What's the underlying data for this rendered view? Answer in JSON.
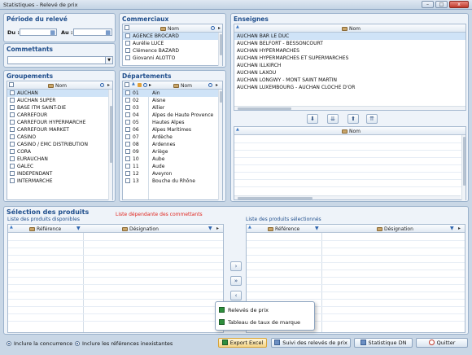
{
  "window": {
    "title": "Statistiques - Relevé de prix"
  },
  "periode": {
    "title": "Période du relevé",
    "du_label": "Du :",
    "au_label": "Au :",
    "du_value": "",
    "au_value": ""
  },
  "commettants": {
    "title": "Commettants",
    "value": ""
  },
  "commerciaux": {
    "title": "Commerciaux",
    "col_nom": "Nom",
    "items": [
      "AGENCE BROCARD",
      "Aurélie LUCE",
      "Clémence BAZARD",
      "Giovanni ALOTTO"
    ]
  },
  "enseignes": {
    "title": "Enseignes",
    "col_nom": "Nom",
    "items": [
      "AUCHAN BAR LE DUC",
      "AUCHAN BELFORT - BESSONCOURT",
      "AUCHAN HYPERMARCHES",
      "AUCHAN HYPERMARCHES ET SUPERMARCHES",
      "AUCHAN ILLKIRCH",
      "AUCHAN LAXOU",
      "AUCHAN LONGWY - MONT SAINT MARTIN",
      "AUCHAN LUXEMBOURG - AUCHAN CLOCHE D'OR"
    ],
    "selected_col_nom": "Nom"
  },
  "groupements": {
    "title": "Groupements",
    "col_nom": "Nom",
    "items": [
      "AUCHAN",
      "AUCHAN SUPER",
      "BASE ITM SAINT-DIE",
      "CARREFOUR",
      "CARREFOUR HYPERMARCHE",
      "CARREFOUR MARKET",
      "CASINO",
      "CASINO / EMC DISTRIBUTION",
      "CORA",
      "EURAUCHAN",
      "GALEC",
      "INDEPENDANT",
      "INTERMARCHE"
    ]
  },
  "departements": {
    "title": "Départements",
    "col_nom": "Nom",
    "items": [
      {
        "code": "01",
        "nom": "Ain"
      },
      {
        "code": "02",
        "nom": "Aisne"
      },
      {
        "code": "03",
        "nom": "Allier"
      },
      {
        "code": "04",
        "nom": "Alpes de Haute Provence"
      },
      {
        "code": "05",
        "nom": "Hautes Alpes"
      },
      {
        "code": "06",
        "nom": "Alpes Maritimes"
      },
      {
        "code": "07",
        "nom": "Ardèche"
      },
      {
        "code": "08",
        "nom": "Ardennes"
      },
      {
        "code": "09",
        "nom": "Ariège"
      },
      {
        "code": "10",
        "nom": "Aube"
      },
      {
        "code": "11",
        "nom": "Aude"
      },
      {
        "code": "12",
        "nom": "Aveyron"
      },
      {
        "code": "13",
        "nom": "Bouche du Rhône"
      }
    ]
  },
  "produits": {
    "title": "Sélection des produits",
    "dispo_label": "Liste des produits disponibles",
    "dependante_label": "Liste dépendante des commettants",
    "selection_label": "Liste des produits sélectionnés",
    "col_reference": "Référence",
    "col_designation": "Désignation"
  },
  "popup": {
    "item1": "Relevés de prix",
    "item2": "Tableau de taux de marque"
  },
  "footer": {
    "radio1": "Inclure la concurrence",
    "radio2": "Inclure les références inexistantes",
    "export": "Export Excel",
    "suivi": "Suivi des relevés de prix",
    "stat_dn": "Statistique DN",
    "quitter": "Quitter"
  }
}
